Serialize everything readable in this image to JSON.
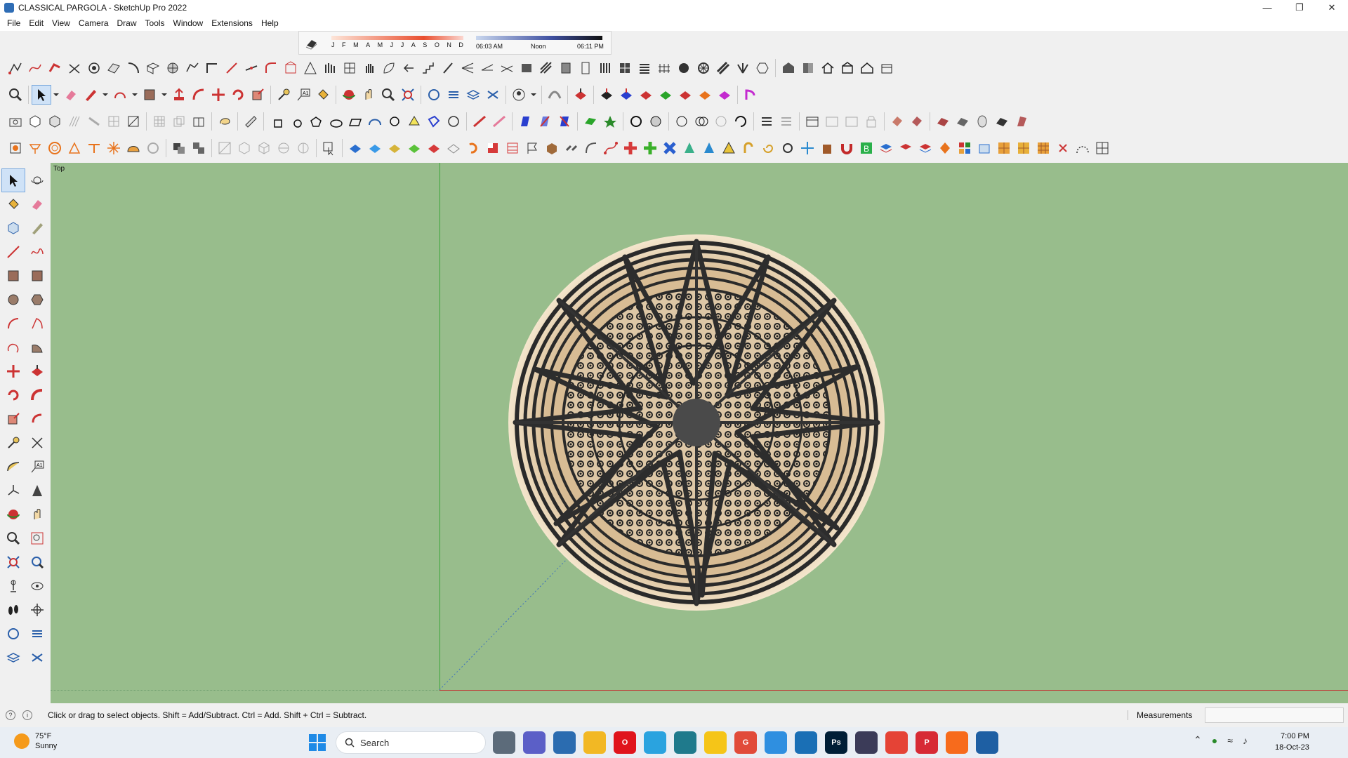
{
  "window": {
    "title": "CLASSICAL PARGOLA - SketchUp Pro 2022",
    "minimize_icon": "minimize-icon",
    "maximize_icon": "restore-icon",
    "close_icon": "close-icon"
  },
  "menu": {
    "items": [
      "File",
      "Edit",
      "View",
      "Camera",
      "Draw",
      "Tools",
      "Window",
      "Extensions",
      "Help"
    ]
  },
  "shadows": {
    "months": [
      "J",
      "F",
      "M",
      "A",
      "M",
      "J",
      "J",
      "A",
      "S",
      "O",
      "N",
      "D"
    ],
    "time_start": "06:03 AM",
    "time_mid": "Noon",
    "time_end": "06:11 PM"
  },
  "viewport": {
    "view_name": "Top",
    "background_color": "#98bd8c"
  },
  "status": {
    "message": "Click or drag to select objects. Shift = Add/Subtract. Ctrl = Add. Shift + Ctrl = Subtract.",
    "measurements_label": "Measurements",
    "measurements_value": ""
  },
  "taskbar": {
    "weather_temp": "75°F",
    "weather_desc": "Sunny",
    "search_placeholder": "Search",
    "time": "7:00 PM",
    "date": "18-Oct-23",
    "apps": [
      {
        "name": "task-view",
        "label": "",
        "color": "#5c6b7a"
      },
      {
        "name": "meet",
        "label": "",
        "color": "#5b5fc7"
      },
      {
        "name": "calculator",
        "label": "",
        "color": "#2b6cb0"
      },
      {
        "name": "file-explorer",
        "label": "",
        "color": "#f2b824"
      },
      {
        "name": "opera",
        "label": "O",
        "color": "#e0141c"
      },
      {
        "name": "telegram",
        "label": "",
        "color": "#2aa3df"
      },
      {
        "name": "maps",
        "label": "",
        "color": "#1f7a8c"
      },
      {
        "name": "sticky-notes",
        "label": "",
        "color": "#f5c518"
      },
      {
        "name": "grammarly",
        "label": "G",
        "color": "#e14b3a"
      },
      {
        "name": "vscode",
        "label": "",
        "color": "#2f8fe0"
      },
      {
        "name": "sketchup-viewer",
        "label": "",
        "color": "#1a6fb5"
      },
      {
        "name": "photoshop",
        "label": "Ps",
        "color": "#001e36"
      },
      {
        "name": "affinity",
        "label": "",
        "color": "#3b3b58"
      },
      {
        "name": "chrome",
        "label": "",
        "color": "#e54336"
      },
      {
        "name": "pinterest",
        "label": "P",
        "color": "#d72a35"
      },
      {
        "name": "soundcloud",
        "label": "",
        "color": "#f76b1c"
      },
      {
        "name": "sketchup",
        "label": "",
        "color": "#1e5fa3"
      }
    ]
  }
}
